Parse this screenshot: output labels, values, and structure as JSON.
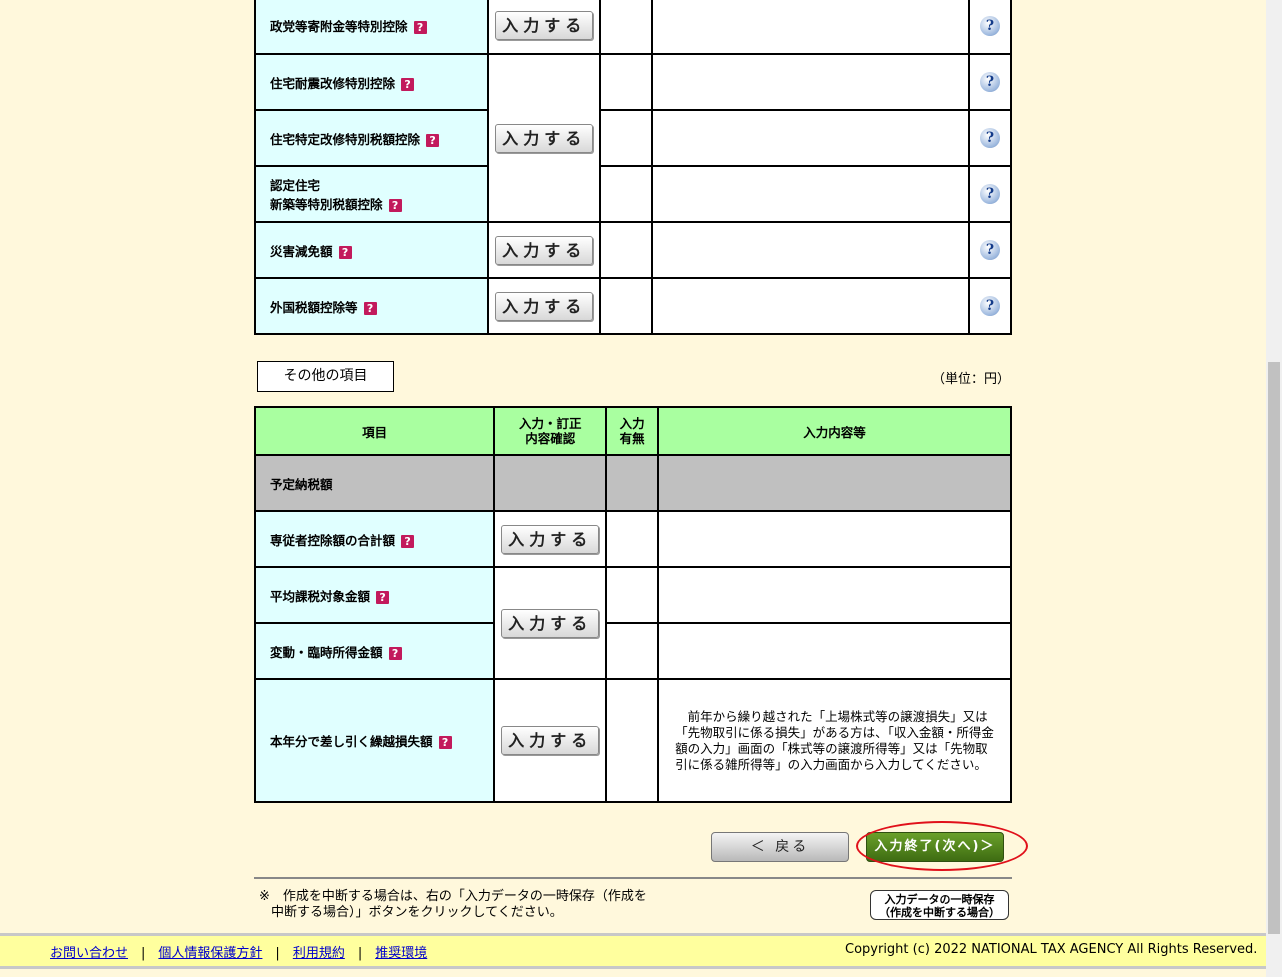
{
  "top_table": {
    "rows": [
      {
        "label": "政党等寄附金等特別控除",
        "has_button": true
      },
      {
        "label": "住宅耐震改修特別控除",
        "has_button": false
      },
      {
        "label": "住宅特定改修特別税額控除",
        "has_button": true
      },
      {
        "label_line1": "認定住宅",
        "label_line2": "新築等特別税額控除",
        "has_button": false
      },
      {
        "label": "災害減免額",
        "has_button": true
      },
      {
        "label": "外国税額控除等",
        "has_button": true
      }
    ],
    "input_button_label": "入力する",
    "help_icon": "help-icon",
    "help_glyph": "?"
  },
  "other_section": {
    "title": "その他の項目",
    "unit": "（単位：円）",
    "headers": {
      "item": "項目",
      "confirm_line1": "入力・訂正",
      "confirm_line2": "内容確認",
      "presence_line1": "入力",
      "presence_line2": "有無",
      "content": "入力内容等"
    },
    "rows": [
      {
        "label": "予定納税額"
      },
      {
        "label": "専従者控除額の合計額"
      },
      {
        "label": "平均課税対象金額"
      },
      {
        "label": "変動・臨時所得金額"
      },
      {
        "label": "本年分で差し引く繰越損失額"
      }
    ],
    "carryover_note": "前年から繰り越された「上場株式等の譲渡損失」又は「先物取引に係る損失」がある方は、「収入金額・所得金額の入力」画面の「株式等の譲渡所得等」又は「先物取引に係る雑所得等」の入力画面から入力してください。",
    "input_button_label": "入力する",
    "question_mark": "?"
  },
  "nav": {
    "back_label": "＜ 戻る",
    "next_label": "入力終了(次へ)＞"
  },
  "footer": {
    "note_line1": "※　作成を中断する場合は、右の「入力データの一時保存（作成を",
    "note_line2": "中断する場合）」ボタンをクリックしてください。",
    "save_line1": "入力データの一時保存",
    "save_line2": "（作成を中断する場合）",
    "links": [
      "お問い合わせ",
      "個人情報保護方針",
      "利用規約",
      "推奨環境"
    ],
    "separator": "|",
    "copyright": "Copyright (c) 2022 NATIONAL TAX AGENCY All Rights Reserved."
  },
  "colors": {
    "page_bg": "#fff8dc",
    "label_bg": "#e0ffff",
    "header_bg": "#a9ffa0",
    "gray_row": "#c0c0c0",
    "next_button": "#4f8a1a",
    "highlight_ellipse": "#e0101a",
    "footer_bg": "#ffff9e"
  }
}
